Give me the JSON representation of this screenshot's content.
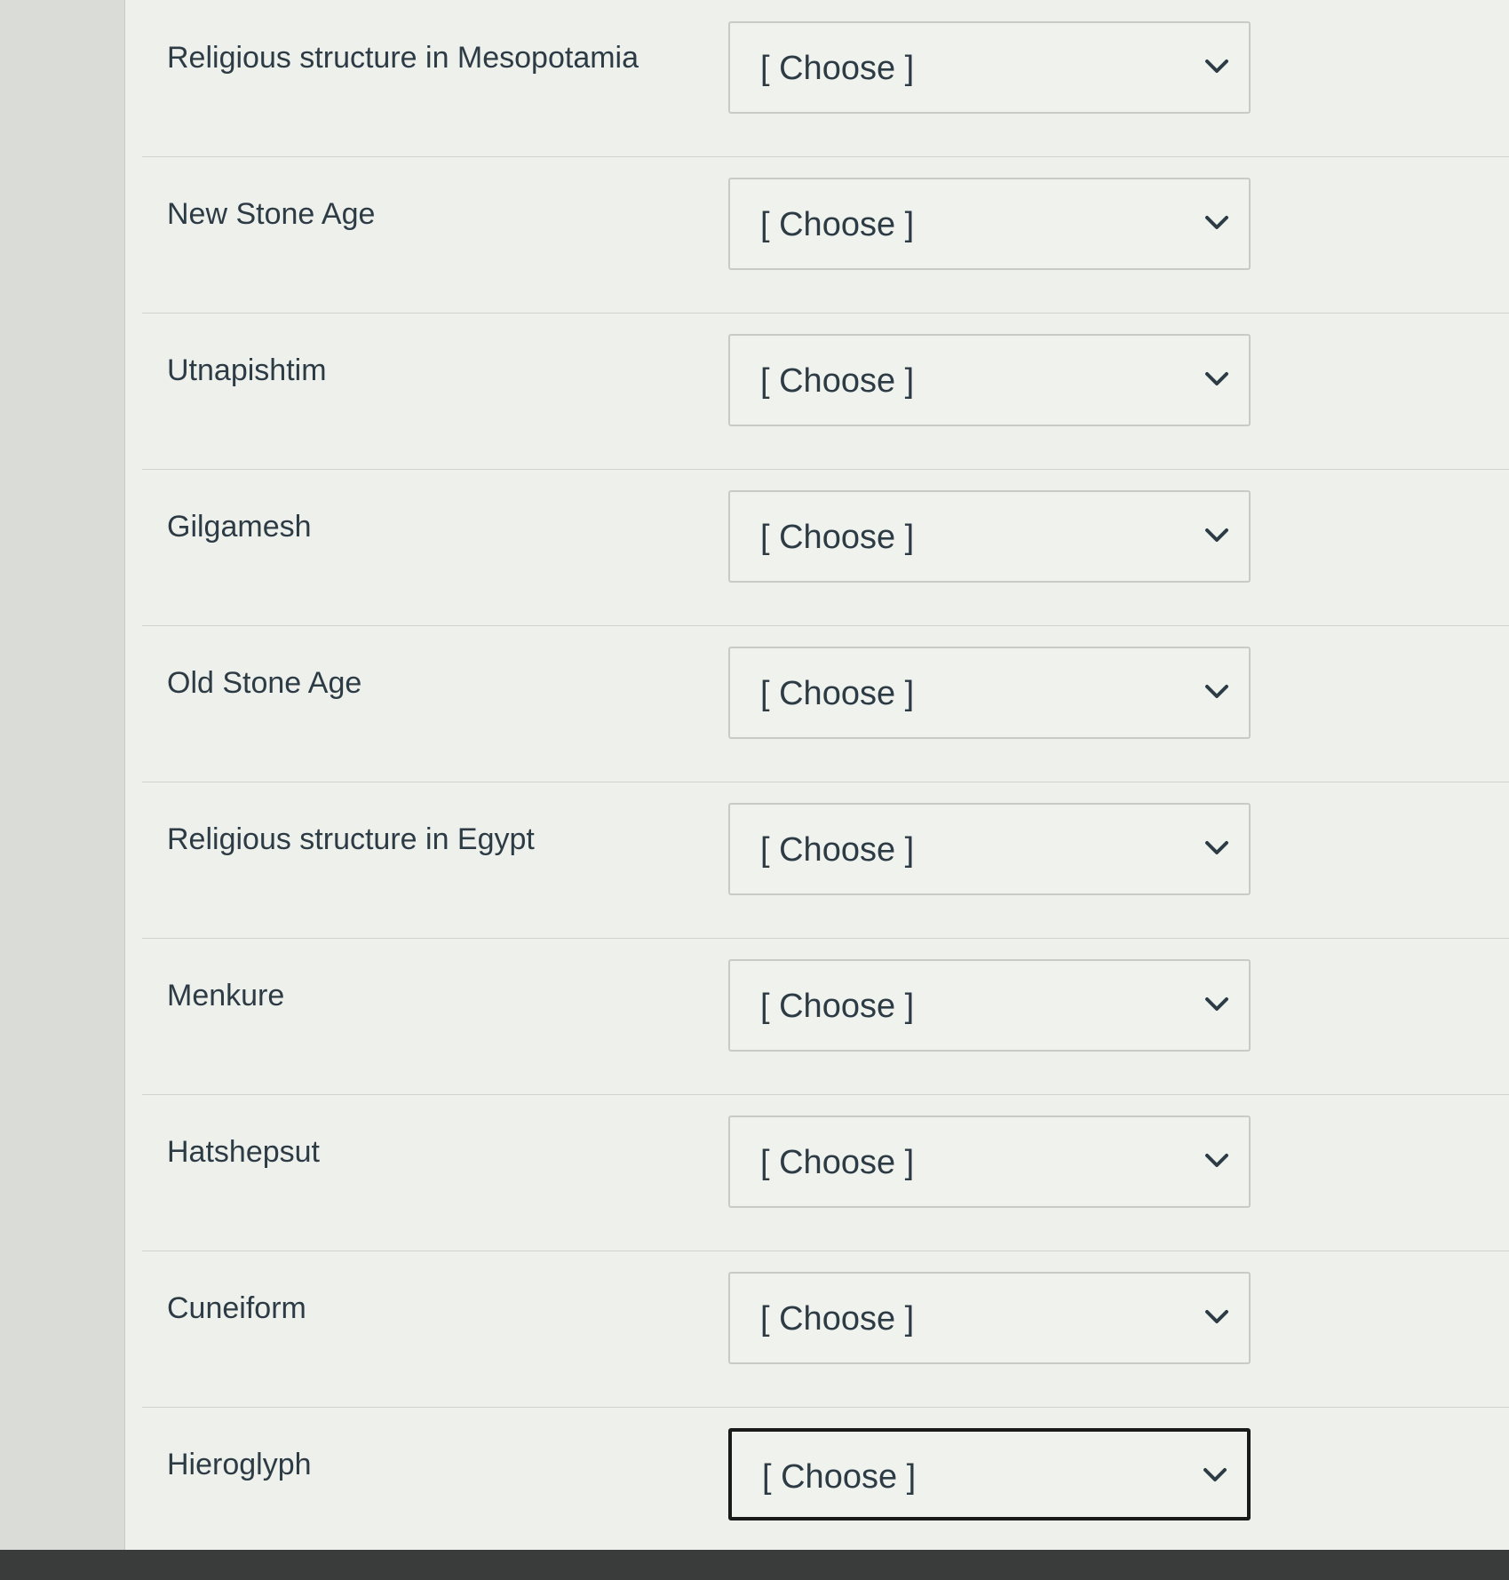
{
  "quiz": {
    "questions": [
      {
        "prompt": "Religious structure in Mesopotamia",
        "selected": "[ Choose ]"
      },
      {
        "prompt": "New Stone Age",
        "selected": "[ Choose ]"
      },
      {
        "prompt": "Utnapishtim",
        "selected": "[ Choose ]"
      },
      {
        "prompt": "Gilgamesh",
        "selected": "[ Choose ]"
      },
      {
        "prompt": "Old Stone Age",
        "selected": "[ Choose ]"
      },
      {
        "prompt": "Religious structure in Egypt",
        "selected": "[ Choose ]"
      },
      {
        "prompt": "Menkure",
        "selected": "[ Choose ]"
      },
      {
        "prompt": "Hatshepsut",
        "selected": "[ Choose ]"
      },
      {
        "prompt": "Cuneiform",
        "selected": "[ Choose ]"
      },
      {
        "prompt": "Hieroglyph",
        "selected": "[ Choose ]"
      }
    ]
  },
  "icons": {
    "dropdown": "chevron-down-icon"
  },
  "colors": {
    "text": "#2d3b45",
    "focus_border": "#1a1a1a"
  }
}
